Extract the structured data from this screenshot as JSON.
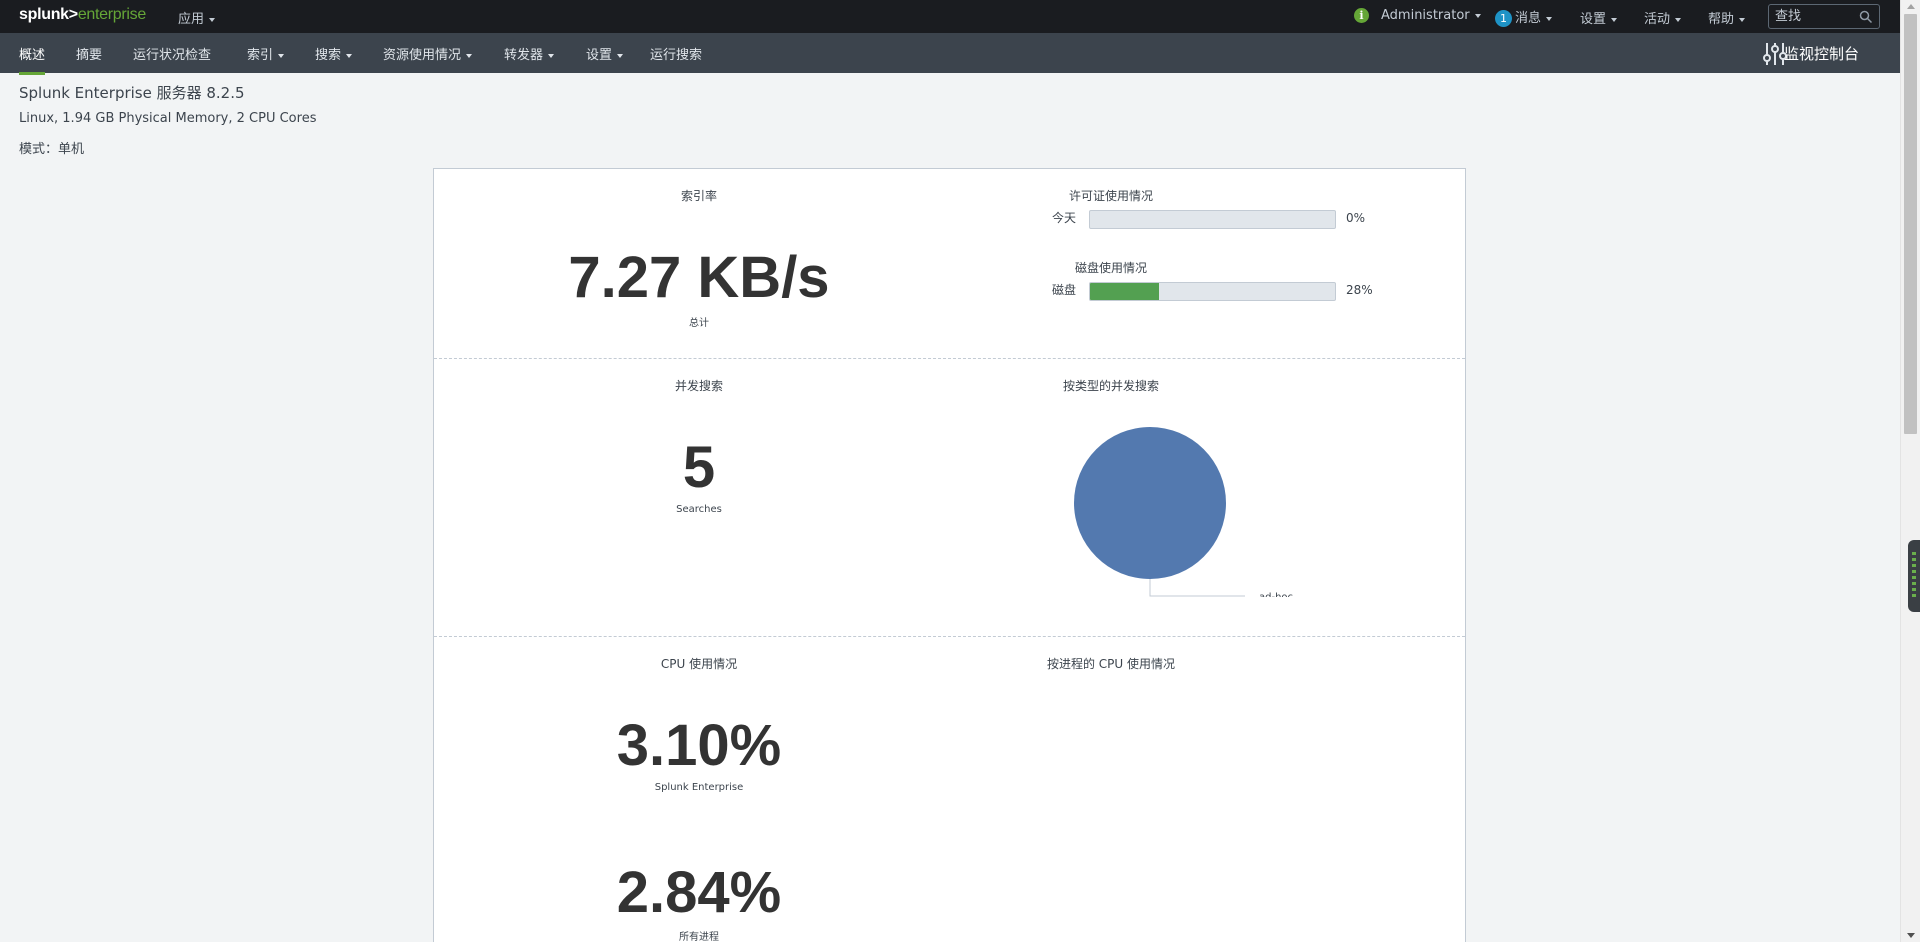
{
  "topbar": {
    "logo_primary": "splunk>",
    "logo_secondary": "enterprise",
    "apps_label": "应用",
    "user_label": "Administrator",
    "messages_count": "1",
    "messages_label": "消息",
    "settings_label": "设置",
    "activity_label": "活动",
    "help_label": "帮助",
    "search_placeholder": "查找"
  },
  "nav": {
    "items": [
      {
        "label": "概述",
        "active": true
      },
      {
        "label": "摘要"
      },
      {
        "label": "运行状况检查"
      },
      {
        "label": "索引"
      },
      {
        "label": "搜索"
      },
      {
        "label": "资源使用情况"
      },
      {
        "label": "转发器"
      },
      {
        "label": "设置"
      },
      {
        "label": "运行搜索"
      }
    ],
    "app_title": "监视控制台"
  },
  "server": {
    "title": "Splunk Enterprise 服务器 8.2.5",
    "specs": "Linux, 1.94 GB Physical Memory, 2 CPU Cores",
    "mode": "模式：单机"
  },
  "panels": {
    "index_rate": {
      "title": "索引率",
      "value": "7.27 KB/s",
      "caption": "总计"
    },
    "license": {
      "title": "许可证使用情况",
      "label": "今天",
      "percent": "0%",
      "fraction": 0.0
    },
    "disk": {
      "title": "磁盘使用情况",
      "label": "磁盘",
      "percent": "28%",
      "fraction": 0.28
    },
    "concurrent": {
      "title": "并发搜索",
      "value": "5",
      "caption": "Searches"
    },
    "by_type": {
      "title": "按类型的并发搜索"
    },
    "cpu": {
      "title": "CPU 使用情况",
      "value": "3.10%",
      "caption": "Splunk Enterprise",
      "value2": "2.84%",
      "caption2": "所有进程"
    },
    "cpu_by_process": {
      "title": "按进程的 CPU 使用情况"
    }
  },
  "colors": {
    "accent": "#65a637",
    "disk_fill": "#53a051",
    "pie": "#5379af",
    "topbar_bg": "#1a1c20",
    "nav_bg": "#3c444d"
  },
  "chart_data": {
    "type": "pie",
    "title": "按类型的并发搜索",
    "categories": [
      "ad-hoc"
    ],
    "values": [
      5
    ]
  }
}
